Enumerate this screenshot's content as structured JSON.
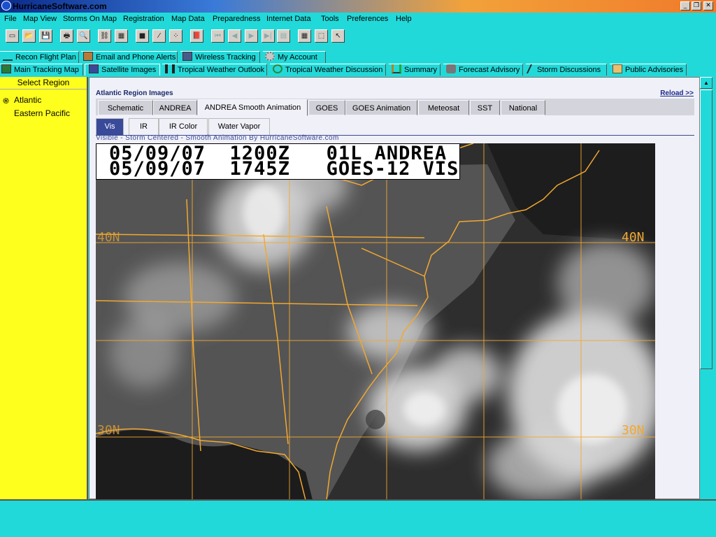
{
  "window": {
    "title": "HurricaneSoftware.com",
    "buttons": [
      "_",
      "❐",
      "✕"
    ]
  },
  "menu": [
    "File",
    "Map View",
    "Storms On Map",
    "Registration",
    "Map Data",
    "Preparedness",
    "Internet Data",
    "Tools",
    "Preferences",
    "Help"
  ],
  "toolbar": {
    "icons": [
      "new-file-icon",
      "open-folder-icon",
      "save-icon",
      "print-icon",
      "print-preview-icon",
      "link-icon",
      "building-icon",
      "box-icon",
      "chart-icon",
      "grid-points-icon",
      "book-icon",
      "first-frame-icon",
      "prev-frame-icon",
      "play-icon",
      "next-frame-icon",
      "last-frame-icon",
      "animation-icon",
      "grid-icon",
      "select-icon",
      "cursor-icon"
    ],
    "glyphs": [
      "▭",
      "📂",
      "💾",
      "🖶",
      "🔍",
      "⛓",
      "▦",
      "■",
      "⁄",
      "⁘",
      "📕",
      "⏮",
      "◀",
      "▶",
      "▶|",
      "⏭",
      "▤",
      "▦",
      "⬚",
      "↖"
    ]
  },
  "tabs_row1": [
    {
      "label": "Recon Flight Plan",
      "icon": "plane-icon"
    },
    {
      "label": "Email and Phone Alerts",
      "icon": "phone-icon"
    },
    {
      "label": "Wireless Tracking",
      "icon": "wireless-icon"
    },
    {
      "label": "My Account",
      "icon": "gear-icon"
    }
  ],
  "tabs_row2": [
    {
      "label": "Main Tracking Map",
      "icon": "map-icon"
    },
    {
      "label": "Satellite Images",
      "icon": "satellite-icon"
    },
    {
      "label": "Tropical Weather Outlook",
      "icon": "binoculars-icon"
    },
    {
      "label": "Tropical Weather Discussion",
      "icon": "refresh-icon"
    },
    {
      "label": "Summary",
      "icon": "bar-chart-icon"
    },
    {
      "label": "Forecast Advisory",
      "icon": "storm-icon"
    },
    {
      "label": "Storm Discussions",
      "icon": "lightning-icon"
    },
    {
      "label": "Public Advisories",
      "icon": "house-icon"
    }
  ],
  "sidebar": {
    "header": "Select Region",
    "items": [
      "Atlantic",
      "Eastern Pacific"
    ]
  },
  "content": {
    "heading": "Atlantic Region Images",
    "reload": "Reload >>",
    "tabs": [
      "Schematic",
      "ANDREA",
      "ANDREA Smooth Animation",
      "GOES",
      "GOES Animation",
      "Meteosat",
      "SST",
      "National"
    ],
    "subtabs": [
      "Vis",
      "IR",
      "IR Color",
      "Water Vapor"
    ],
    "caption": "Visible - Storm Centered - Smooth Animation By HurricaneSoftware.com",
    "image": {
      "line1": "05/09/07  1200Z   01L ANDREA",
      "line2": "05/09/07  1745Z   GOES-12 VIS",
      "lat_40": "40N",
      "lat_40_left": "40N",
      "lat_30": "30N",
      "lat_30_left": "30N"
    }
  },
  "colors": {
    "app_bg": "#22d9d9",
    "sidebar_bg": "#ffff1e",
    "selected_subtab": "#3a4a9a",
    "map_lines": "#f2a830"
  }
}
